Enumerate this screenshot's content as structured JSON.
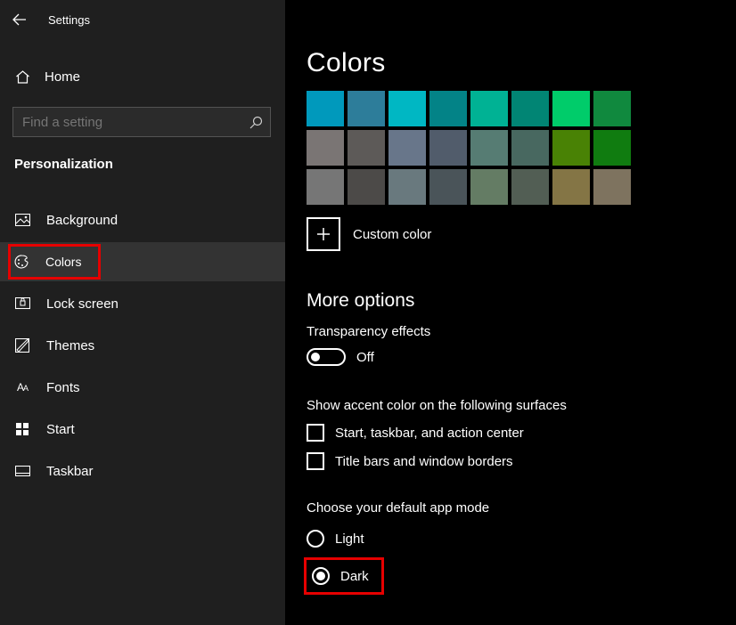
{
  "window": {
    "title": "Settings"
  },
  "sidebar": {
    "home": "Home",
    "search_placeholder": "Find a setting",
    "category": "Personalization",
    "items": [
      {
        "label": "Background"
      },
      {
        "label": "Colors"
      },
      {
        "label": "Lock screen"
      },
      {
        "label": "Themes"
      },
      {
        "label": "Fonts"
      },
      {
        "label": "Start"
      },
      {
        "label": "Taskbar"
      }
    ]
  },
  "main": {
    "title": "Colors",
    "swatches": [
      [
        "#0099bc",
        "#2d7d9a",
        "#00b7c3",
        "#038387",
        "#00b294",
        "#018574",
        "#00cc6a",
        "#10893e"
      ],
      [
        "#7a7574",
        "#5d5a58",
        "#68768a",
        "#515c6b",
        "#567c73",
        "#486860",
        "#498205",
        "#107c10"
      ],
      [
        "#767676",
        "#4c4a48",
        "#69797e",
        "#4a5459",
        "#647c64",
        "#525e54",
        "#847545",
        "#7e735f"
      ]
    ],
    "custom_color_label": "Custom color",
    "more_options_heading": "More options",
    "transparency_label": "Transparency effects",
    "transparency_state": "Off",
    "accent_surfaces_label": "Show accent color on the following surfaces",
    "accent_checkboxes": [
      "Start, taskbar, and action center",
      "Title bars and window borders"
    ],
    "app_mode_label": "Choose your default app mode",
    "app_mode_options": [
      {
        "label": "Light",
        "checked": false
      },
      {
        "label": "Dark",
        "checked": true
      }
    ]
  }
}
